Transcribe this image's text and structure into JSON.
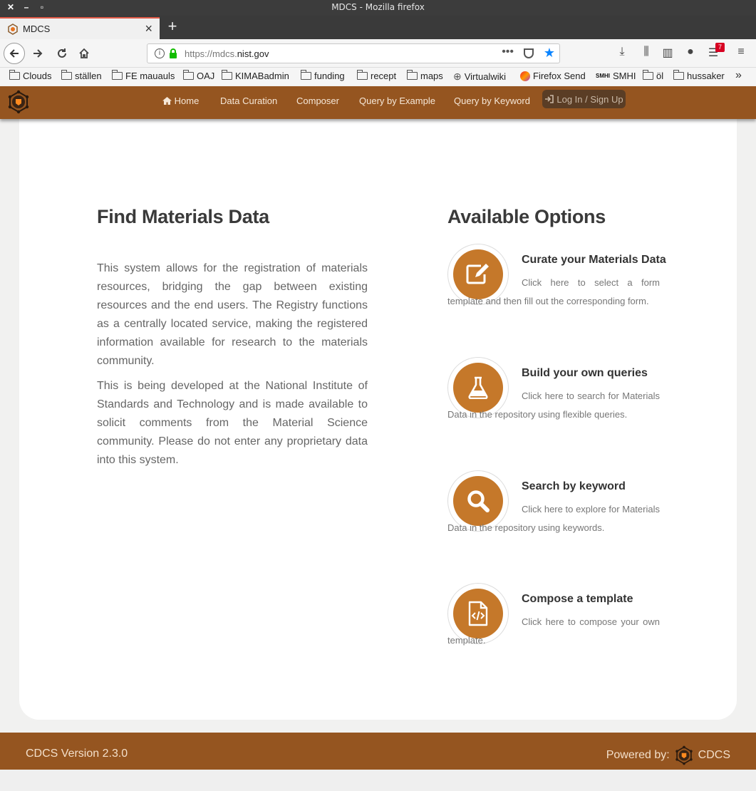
{
  "window": {
    "title": "MDCS - Mozilla firefox",
    "controls": [
      "✕",
      "–",
      "▫"
    ]
  },
  "tab": {
    "title": "MDCS",
    "close": "×",
    "new_tab": "+"
  },
  "toolbar": {
    "url_prefix": "https://mdcs.",
    "url_domain": "nist.gov",
    "page_actions": "•••",
    "notification_count": "7"
  },
  "bookmarks": [
    {
      "label": "Clouds",
      "icon": "folder-icon"
    },
    {
      "label": "ställen",
      "icon": "folder-icon"
    },
    {
      "label": "FE mauauls",
      "icon": "folder-icon"
    },
    {
      "label": "OAJ",
      "icon": "folder-icon"
    },
    {
      "label": "KIMABadmin",
      "icon": "folder-icon"
    },
    {
      "label": "funding",
      "icon": "folder-icon"
    },
    {
      "label": "recept",
      "icon": "folder-icon"
    },
    {
      "label": "maps",
      "icon": "folder-icon"
    },
    {
      "label": "Virtualwiki",
      "icon": "globe-icon"
    },
    {
      "label": "Firefox Send",
      "icon": "send-icon"
    },
    {
      "label": "SMHI",
      "icon": "smhi-icon"
    },
    {
      "label": "öl",
      "icon": "folder-icon"
    },
    {
      "label": "hussaker",
      "icon": "folder-icon"
    }
  ],
  "site": {
    "nav": [
      "Home",
      "Data Curation",
      "Composer",
      "Query by Example",
      "Query by Keyword"
    ],
    "login": "Log In / Sign Up",
    "brand_color": "#955520",
    "accent_color": "#c5782a"
  },
  "main": {
    "left_title": "Find Materials Data",
    "para1": "This system allows for the registration of materials resources, bridging the gap between existing resources and the end users. The Registry functions as a centrally located service, making the registered information available for research to the materials community.",
    "para2": "This is being developed at the National Institute of Standards and Technology and is made available to solicit comments from the Material Science community. Please do not enter any proprietary data into this system.",
    "right_title": "Available Options",
    "options": [
      {
        "title": "Curate your Materials Data",
        "desc": "Click here to select a form template and then fill out the corresponding form.",
        "icon": "edit-icon"
      },
      {
        "title": "Build your own queries",
        "desc": "Click here to search for Materials Data in the repository using flexible queries.",
        "icon": "flask-icon"
      },
      {
        "title": "Search by keyword",
        "desc": "Click here to explore for Materials Data in the repository using keywords.",
        "icon": "search-icon"
      },
      {
        "title": "Compose a template",
        "desc": "Click here to compose your own template.",
        "icon": "code-file-icon"
      }
    ]
  },
  "footer": {
    "version": "CDCS Version 2.3.0",
    "powered_by": "Powered by:",
    "brand": "CDCS"
  }
}
